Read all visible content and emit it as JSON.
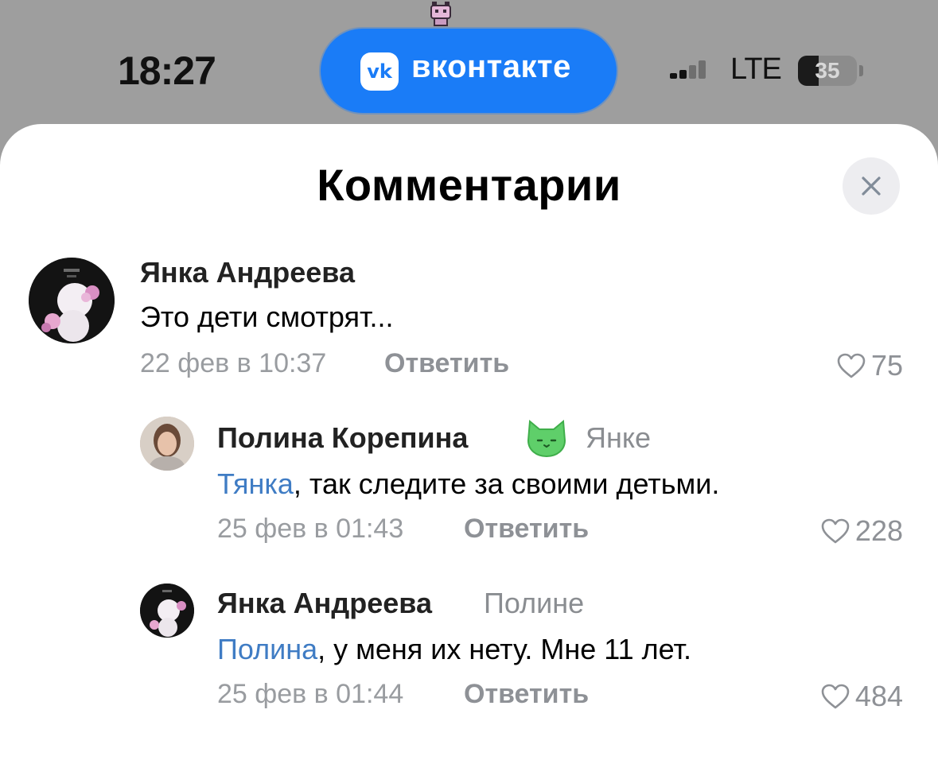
{
  "status_bar": {
    "time": "18:27",
    "app_name": "вконтакте",
    "app_logo_text": "vk",
    "network": "LTE",
    "battery": "35",
    "battery_level": 0.35
  },
  "sheet": {
    "title": "Комментарии"
  },
  "comments": [
    {
      "author": "Янка Андреева",
      "reply_to": "",
      "mention": "",
      "text": "Это дети смотрят...",
      "date": "22 фев в 10:37",
      "reply_label": "Ответить",
      "likes": "75"
    },
    {
      "author": "Полина Корепина",
      "reply_to": "Янке",
      "mention": "Тянка",
      "text": ", так следите за своими детьми.",
      "date": "25 фев в 01:43",
      "reply_label": "Ответить",
      "likes": "228"
    },
    {
      "author": "Янка Андреева",
      "reply_to": "Полине",
      "mention": "Полина",
      "text": ", у меня их нету. Мне 11 лет.",
      "date": "25 фев в 01:44",
      "reply_label": "Ответить",
      "likes": "484"
    }
  ],
  "colors": {
    "vk_blue": "#1a7cf7",
    "mention": "#3f7cc4",
    "secondary_text": "#999ca0"
  }
}
